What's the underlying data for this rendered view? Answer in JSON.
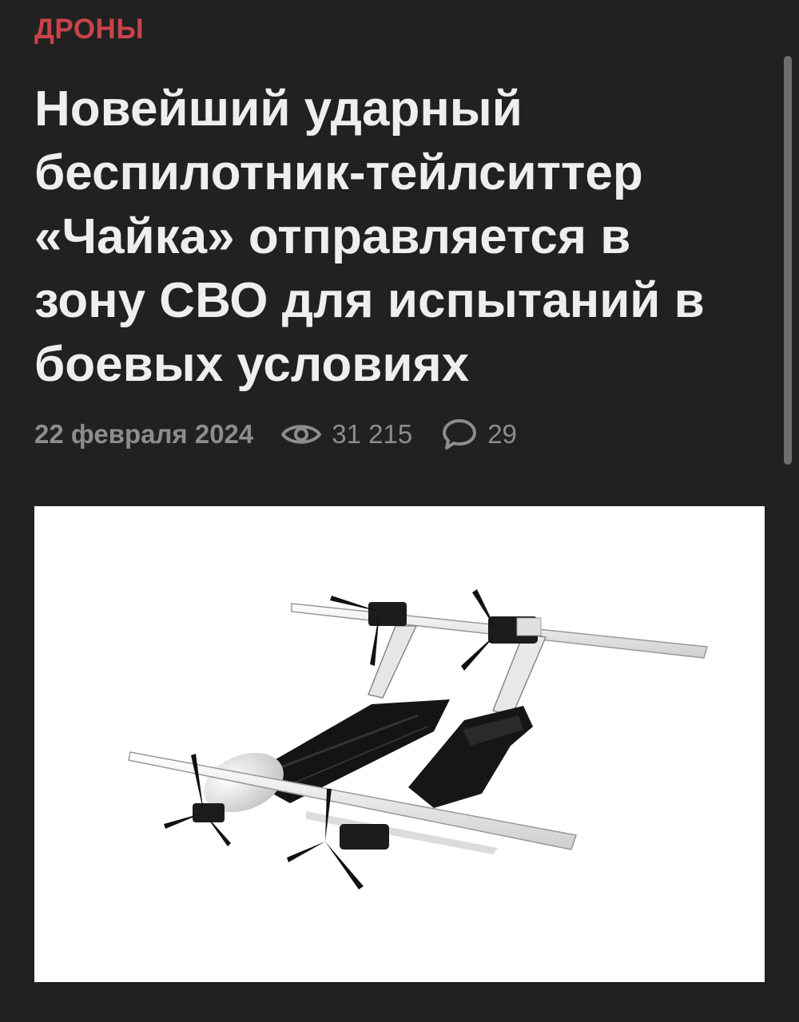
{
  "article": {
    "category": "ДРОНЫ",
    "title": "Новейший ударный беспилотник-тейлситтер «Чайка» отправляется в зону СВО для испытаний в боевых условиях",
    "date": "22 февраля 2024",
    "views": "31 215",
    "comments": "29",
    "image_icon": "drone-photo"
  },
  "colors": {
    "background": "#212121",
    "category": "#c9434a",
    "title": "#eeeeee",
    "meta": "#8d8d8d"
  },
  "icons": {
    "views": "eye-icon",
    "comments": "speech-bubble-icon"
  }
}
